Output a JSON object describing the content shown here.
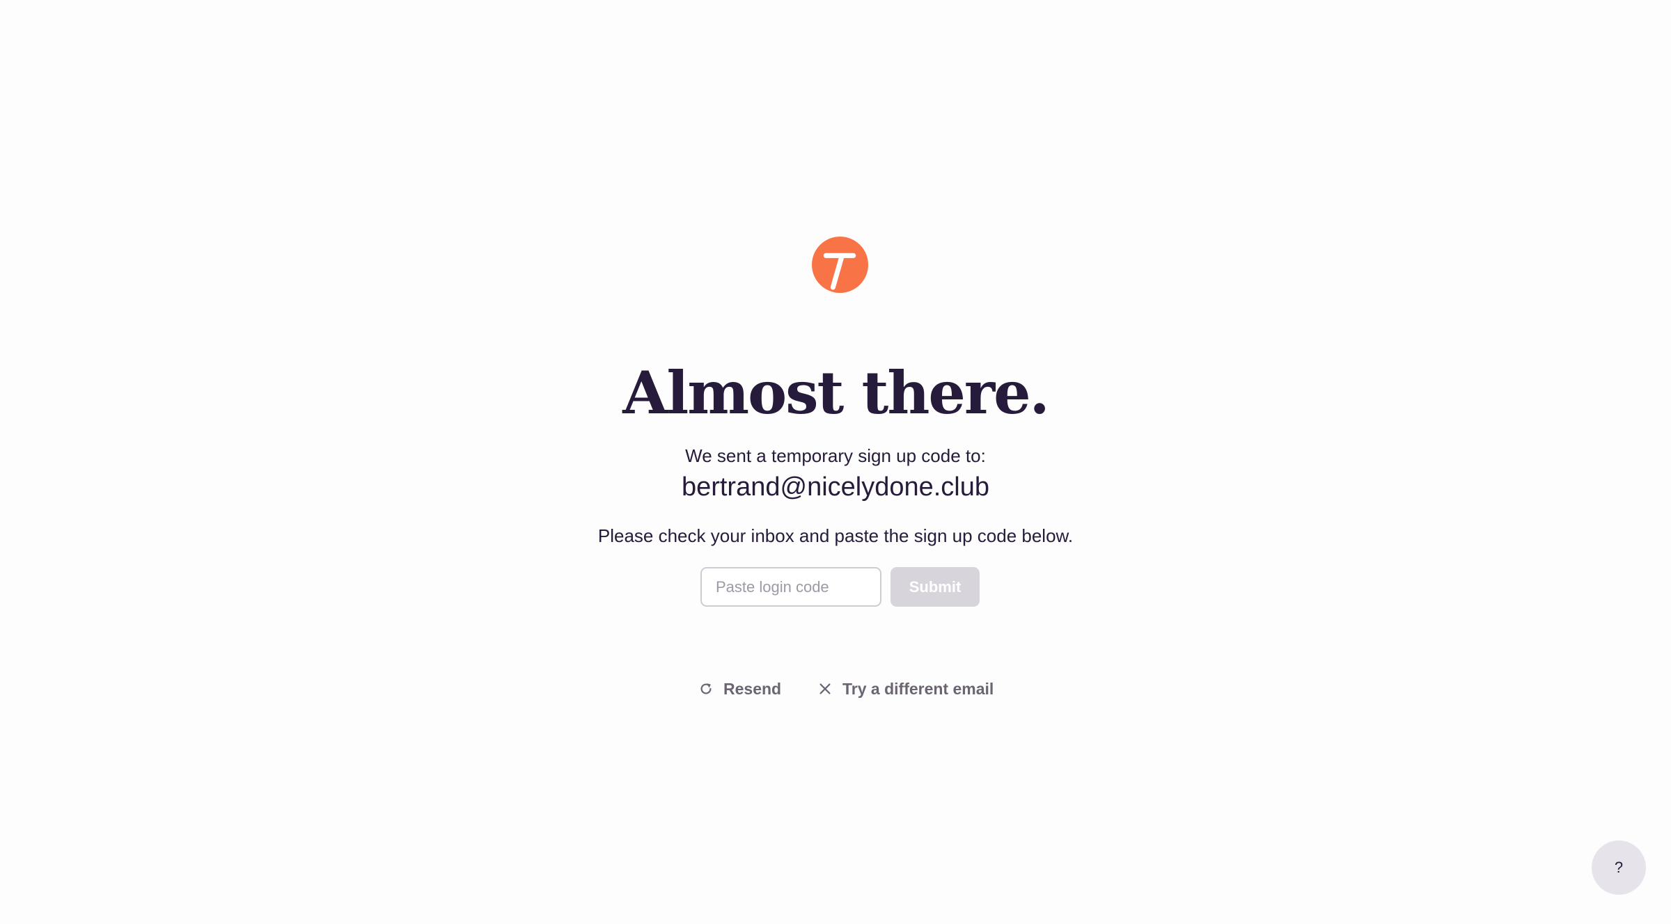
{
  "brand": {
    "logo_icon": "toggl-logo-icon",
    "accent_color": "#f87447"
  },
  "heading": "Almost there.",
  "sent_label": "We sent a temporary sign up code to:",
  "email": "bertrand@nicelydone.club",
  "instructions": "Please check your inbox and paste the sign up code below.",
  "code_field": {
    "value": "",
    "placeholder": "Paste login code"
  },
  "submit_label": "Submit",
  "actions": {
    "resend_label": "Resend",
    "resend_icon": "refresh-icon",
    "different_email_label": "Try a different email",
    "different_email_icon": "close-icon"
  },
  "help": {
    "label": "?"
  },
  "colors": {
    "text": "#261b3a",
    "muted": "#6b6473",
    "disabled_button": "#d7d4db",
    "background": "#fefdfd"
  }
}
